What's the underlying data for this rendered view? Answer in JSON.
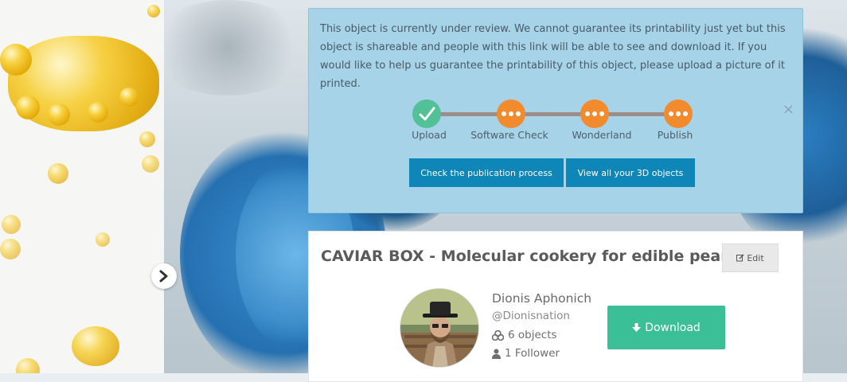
{
  "notice": {
    "text": "This object is currently under review. We cannot guarantee its printability just yet but this object is shareable and people with this link will be able to see and download it. If you would like to help us guarantee the printability of this object, please upload a picture of it printed.",
    "close_glyph": "×",
    "steps": [
      {
        "label": "Upload",
        "state": "done"
      },
      {
        "label": "Software Check",
        "state": "pending"
      },
      {
        "label": "Wonderland",
        "state": "pending"
      },
      {
        "label": "Publish",
        "state": "pending"
      }
    ],
    "buttons": {
      "check_process": "Check the publication process",
      "view_objects": "View all your 3D objects"
    }
  },
  "object": {
    "title": "CAVIAR BOX - Molecular cookery for edible pearls",
    "edit_label": "Edit"
  },
  "author": {
    "name": "Dionis Aphonich",
    "handle": "@Dionisnation",
    "objects": "6 objects",
    "followers": "1 Follower"
  },
  "download_label": "Download",
  "icons": {
    "check": "check-icon",
    "dots": "ellipsis-icon",
    "edit": "edit-icon",
    "objects": "cubes-icon",
    "follower": "user-icon",
    "download": "download-arrow-icon",
    "carousel_next": "chevron-right-icon",
    "close": "close-icon"
  },
  "colors": {
    "notice_bg": "#a7d3e9",
    "step_done": "#52c197",
    "step_pending": "#f28a2e",
    "button_blue": "#0e86b8",
    "download_green": "#3bbf96"
  }
}
